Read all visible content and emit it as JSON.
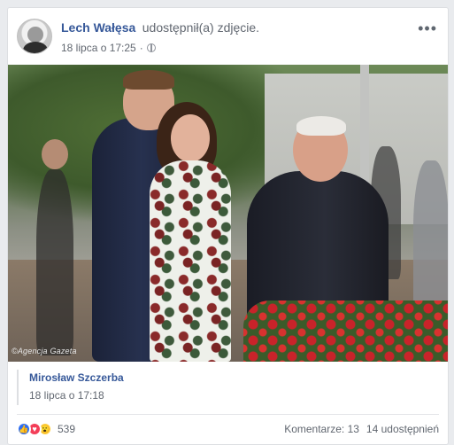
{
  "post": {
    "author": "Lech Wałęsa",
    "action": "udostępnił(a) zdjęcie.",
    "timestamp": "18 lipca o 17:25",
    "privacy_icon": "globe-icon",
    "menu_icon": "more-horizontal-icon",
    "photo": {
      "watermark": "©Agencja Gazeta"
    }
  },
  "shared_from": {
    "author": "Mirosław Szczerba",
    "timestamp": "18 lipca o 17:18"
  },
  "footer": {
    "reactions": [
      "like",
      "love",
      "wow"
    ],
    "reaction_count": "539",
    "comments": "Komentarze: 13",
    "shares": "14 udostępnień"
  },
  "colors": {
    "link": "#365899",
    "meta": "#616770",
    "background": "#e9ebee"
  }
}
